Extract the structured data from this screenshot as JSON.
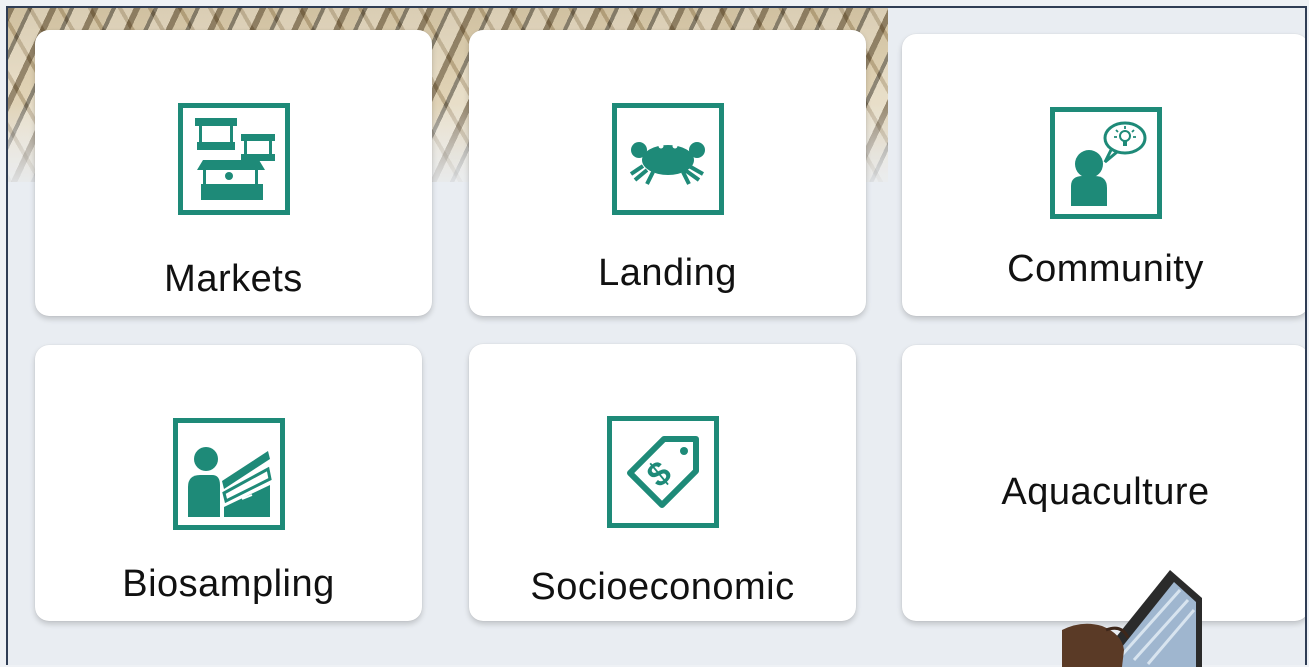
{
  "cards": [
    {
      "label": "Markets",
      "icon": "market-stalls-icon"
    },
    {
      "label": "Landing",
      "icon": "crab-icon"
    },
    {
      "label": "Community",
      "icon": "person-idea-icon"
    },
    {
      "label": "Biosampling",
      "icon": "person-sampling-icon"
    },
    {
      "label": "Socioeconomic",
      "icon": "price-tag-icon"
    },
    {
      "label": "Aquaculture",
      "icon": ""
    }
  ],
  "colors": {
    "accent": "#1e8a78",
    "frame": "#2f3d55",
    "card": "#ffffff"
  }
}
